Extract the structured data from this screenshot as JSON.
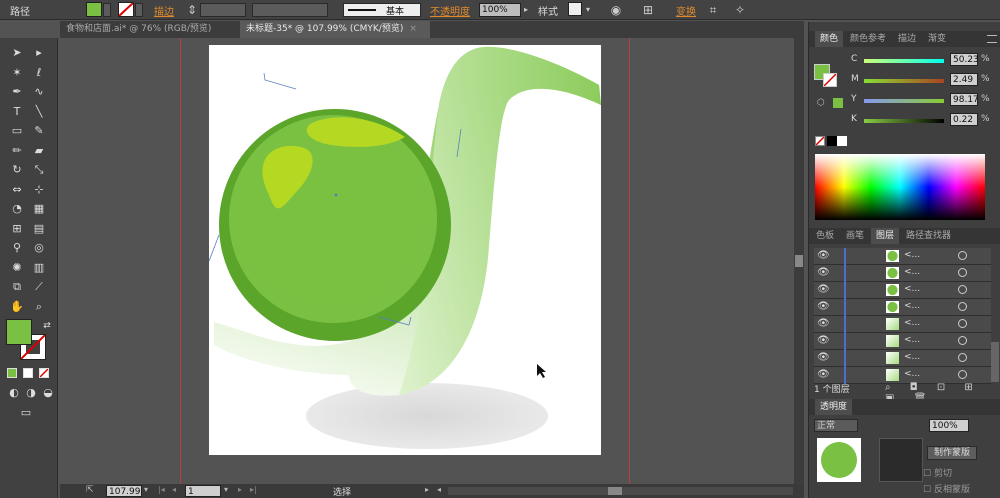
{
  "control_bar": {
    "selection_label": "路径",
    "stroke_label": "描边",
    "stroke_profile": "基本",
    "opacity_label": "不透明度",
    "opacity_value": "100%",
    "style_label": "样式",
    "transform_label": "变换"
  },
  "tabs": [
    {
      "label": "食物和店面.ai* @ 76% (RGB/预览)"
    },
    {
      "label": "未标题-35* @ 107.99% (CMYK/预览)"
    }
  ],
  "tools": [
    "selection-tool",
    "direct-selection-tool",
    "magic-wand-tool",
    "lasso-tool",
    "pen-tool",
    "curvature-tool",
    "type-tool",
    "line-tool",
    "rectangle-tool",
    "paintbrush-tool",
    "pencil-tool",
    "eraser-tool",
    "rotate-tool",
    "scale-tool",
    "width-tool",
    "free-transform-tool",
    "shape-builder-tool",
    "perspective-tool",
    "mesh-tool",
    "gradient-tool",
    "eyedropper-tool",
    "blend-tool",
    "symbol-sprayer-tool",
    "column-graph-tool",
    "artboard-tool",
    "slice-tool",
    "hand-tool",
    "zoom-tool"
  ],
  "colors": {
    "fill": "#7ac143",
    "ball_dark": "#5aa52a",
    "ball_mid": "#7ac143",
    "highlight": "#b5d823",
    "ribbon_light": "#d8f0c4",
    "ribbon_dark": "#8ccc5c",
    "shadow": "#d8d8d8"
  },
  "status": {
    "zoom": "107.99",
    "page": "1",
    "tool": "选择"
  },
  "color_panel": {
    "tabs": [
      "颜色",
      "颜色参考",
      "描边",
      "渐变"
    ],
    "channels": [
      {
        "name": "C",
        "value": "50.23",
        "pct": "%"
      },
      {
        "name": "M",
        "value": "2.49",
        "pct": "%"
      },
      {
        "name": "Y",
        "value": "98.17",
        "pct": "%"
      },
      {
        "name": "K",
        "value": "0.22",
        "pct": "%"
      }
    ]
  },
  "layers_panel": {
    "tabs": [
      "色板",
      "画笔",
      "图层",
      "路径查找器"
    ],
    "rows": [
      "<...",
      "<...",
      "<...",
      "<...",
      "<...",
      "<...",
      "<...",
      "<..."
    ],
    "count": "1 个图层"
  },
  "transparency_panel": {
    "tab": "透明度",
    "mode": "正常",
    "opacity": "100%",
    "make_mask": "制作蒙版",
    "clip": "剪切",
    "invert": "反相蒙版"
  }
}
